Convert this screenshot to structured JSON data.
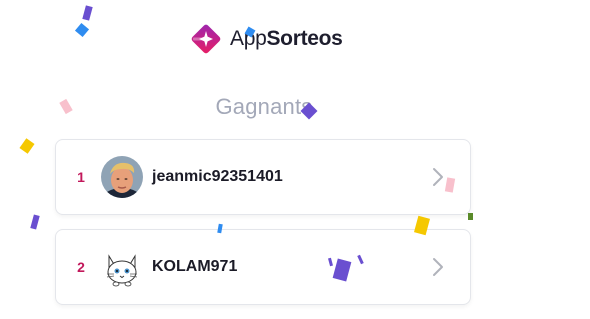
{
  "brand": {
    "name_prefix": "App",
    "name_suffix": "Sorteos"
  },
  "title": "Gagnants",
  "winners": [
    {
      "rank": "1",
      "username": "jeanmic92351401",
      "avatar": "portrait-photo"
    },
    {
      "rank": "2",
      "username": "KOLAM971",
      "avatar": "white-cat-cartoon"
    }
  ],
  "colors": {
    "brand_magenta": "#c2185b",
    "brand_purple": "#8e24aa",
    "title_gray": "#a3a8b8",
    "rank_color": "#c2185b"
  }
}
